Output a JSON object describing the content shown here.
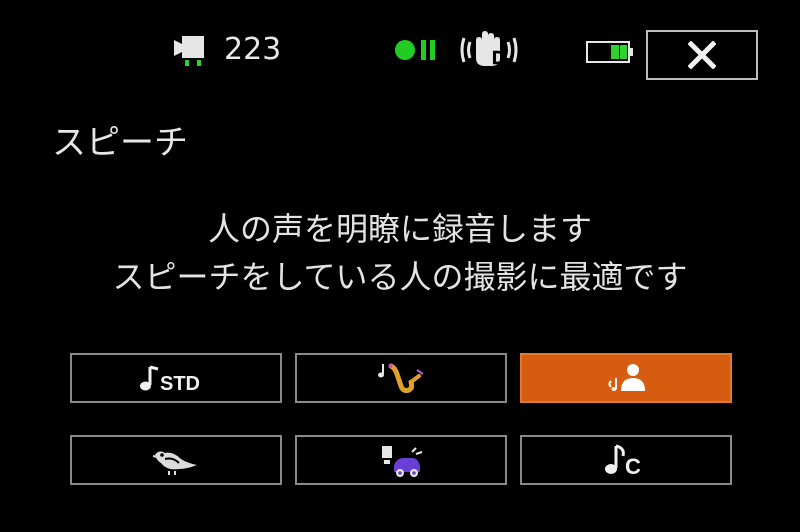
{
  "status_bar": {
    "record_icon": "movie-camera-icon",
    "shots_remaining": "223",
    "record_status_icon": "record-pause-icon",
    "stabilizer_icon": "dynamic-image-stabilizer-icon",
    "battery_icon": "battery-icon",
    "close_icon": "close-icon"
  },
  "mode_title": "スピーチ",
  "description": {
    "line1": "人の声を明瞭に録音します",
    "line2": "スピーチをしている人の撮影に最適です"
  },
  "options": [
    {
      "id": "standard",
      "icon": "music-note-std-icon",
      "text": "STD",
      "selected": false
    },
    {
      "id": "music",
      "icon": "saxophone-icon",
      "selected": false
    },
    {
      "id": "speech",
      "icon": "speech-person-icon",
      "selected": true
    },
    {
      "id": "forest-birds",
      "icon": "bird-icon",
      "selected": false
    },
    {
      "id": "noise-suppression",
      "icon": "noise-suppression-icon",
      "selected": false
    },
    {
      "id": "custom",
      "icon": "music-note-c-icon",
      "text": "C",
      "selected": false
    }
  ],
  "colors": {
    "background": "#000000",
    "selected": "#d65d10",
    "record_green": "#22cc22",
    "border": "#8a8a8a"
  }
}
